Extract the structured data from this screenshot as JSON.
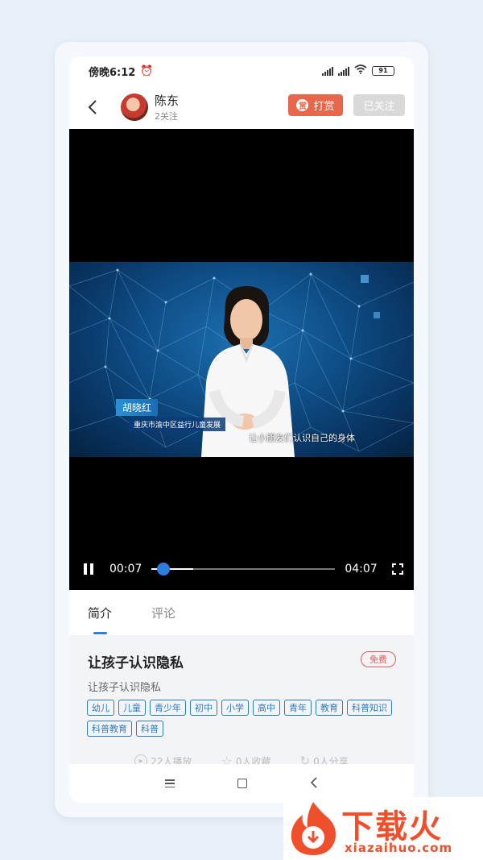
{
  "status_bar": {
    "time": "傍晚6:12",
    "battery": "91"
  },
  "header": {
    "user_name": "陈东",
    "follow_count": "2关注",
    "tip_label": "打赏",
    "followed_label": "已关注"
  },
  "video": {
    "overlay_name": "胡晓红",
    "overlay_org": "重庆市渝中区益行儿童发展",
    "subtitle": "让小朋友们认识自己的身体",
    "current_time": "00:07",
    "total_time": "04:07",
    "progress": 0.03
  },
  "tabs": [
    {
      "label": "简介",
      "active": true
    },
    {
      "label": "评论",
      "active": false
    }
  ],
  "detail": {
    "title": "让孩子认识隐私",
    "badge": "免费",
    "description": "让孩子认识隐私",
    "tags": [
      "幼儿",
      "儿童",
      "青少年",
      "初中",
      "小学",
      "高中",
      "青年",
      "教育",
      "科普知识",
      "科普教育",
      "科普"
    ]
  },
  "stats": {
    "plays": "22人播放",
    "favorites": "0人收藏",
    "shares": "0人分享"
  },
  "watermark": {
    "brand": "下载火",
    "url": "xiazaihuo.com"
  },
  "colors": {
    "accent": "#2f7de1",
    "tip": "#e8664a",
    "free_badge": "#e25b58",
    "tag": "#2f7bbf",
    "brand": "#ef4f2a"
  }
}
